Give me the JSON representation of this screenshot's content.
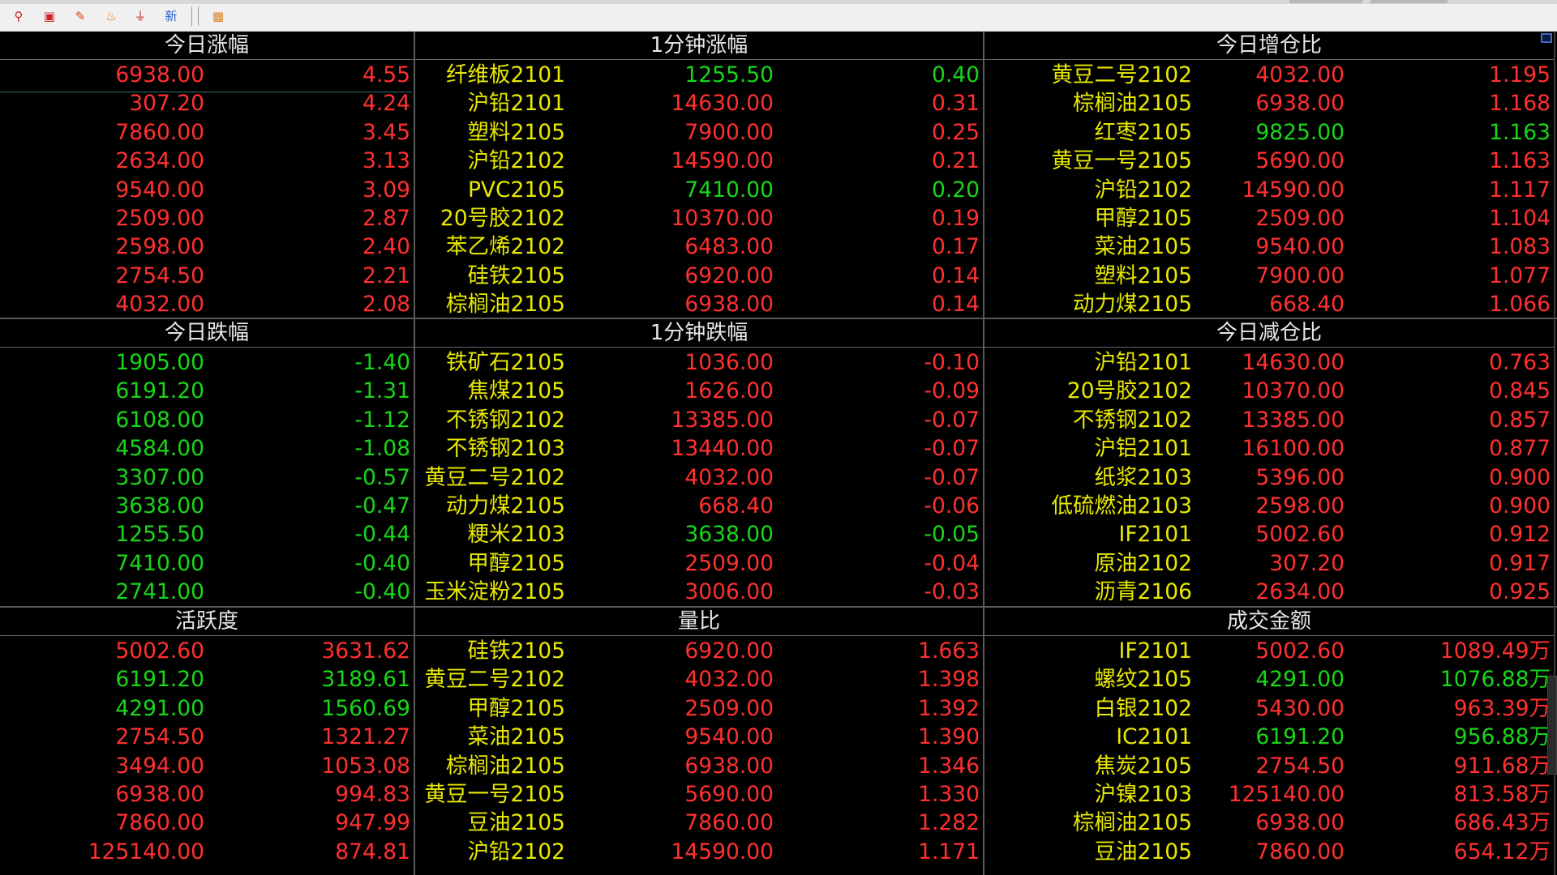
{
  "toolbar": {
    "icons": [
      {
        "name": "search-icon",
        "glyph": "⚲",
        "color": "#d02020"
      },
      {
        "name": "windows-icon",
        "glyph": "▣",
        "color": "#d02020"
      },
      {
        "name": "pencil-icon",
        "glyph": "✎",
        "color": "#e04010"
      },
      {
        "name": "flame-icon",
        "glyph": "♨",
        "color": "#e07010"
      },
      {
        "name": "funnel-icon",
        "glyph": "⏚",
        "color": "#c02020"
      },
      {
        "name": "new-icon",
        "glyph": "新",
        "color": "#2060d0"
      },
      {
        "name": "calendar-icon",
        "glyph": "▦",
        "color": "#e08020"
      }
    ]
  },
  "colors": {
    "up": "#ff3030",
    "down": "#19d619",
    "name": "#e8e800",
    "title": "#e6e6e6"
  },
  "panels": {
    "today_rise": {
      "title": "今日涨幅",
      "rows": [
        {
          "price": "6938.00",
          "change": "4.55",
          "c": "red"
        },
        {
          "price": "307.20",
          "change": "4.24",
          "c": "red"
        },
        {
          "price": "7860.00",
          "change": "3.45",
          "c": "red"
        },
        {
          "price": "2634.00",
          "change": "3.13",
          "c": "red"
        },
        {
          "price": "9540.00",
          "change": "3.09",
          "c": "red"
        },
        {
          "price": "2509.00",
          "change": "2.87",
          "c": "red"
        },
        {
          "price": "2598.00",
          "change": "2.40",
          "c": "red"
        },
        {
          "price": "2754.50",
          "change": "2.21",
          "c": "red"
        },
        {
          "price": "4032.00",
          "change": "2.08",
          "c": "red"
        }
      ]
    },
    "minute_rise": {
      "title": "1分钟涨幅",
      "rows": [
        {
          "name": "纤维板2101",
          "price": "1255.50",
          "value": "0.40",
          "pc": "green",
          "vc": "green"
        },
        {
          "name": "沪铅2101",
          "price": "14630.00",
          "value": "0.31",
          "pc": "red",
          "vc": "red"
        },
        {
          "name": "塑料2105",
          "price": "7900.00",
          "value": "0.25",
          "pc": "red",
          "vc": "red"
        },
        {
          "name": "沪铅2102",
          "price": "14590.00",
          "value": "0.21",
          "pc": "red",
          "vc": "red"
        },
        {
          "name": "PVC2105",
          "price": "7410.00",
          "value": "0.20",
          "pc": "green",
          "vc": "green"
        },
        {
          "name": "20号胶2102",
          "price": "10370.00",
          "value": "0.19",
          "pc": "red",
          "vc": "red"
        },
        {
          "name": "苯乙烯2102",
          "price": "6483.00",
          "value": "0.17",
          "pc": "red",
          "vc": "red"
        },
        {
          "name": "硅铁2105",
          "price": "6920.00",
          "value": "0.14",
          "pc": "red",
          "vc": "red"
        },
        {
          "name": "棕榈油2105",
          "price": "6938.00",
          "value": "0.14",
          "pc": "red",
          "vc": "red"
        }
      ]
    },
    "oi_increase": {
      "title": "今日增仓比",
      "rows": [
        {
          "name": "黄豆二号2102",
          "price": "4032.00",
          "value": "1.195",
          "pc": "red",
          "vc": "red"
        },
        {
          "name": "棕榈油2105",
          "price": "6938.00",
          "value": "1.168",
          "pc": "red",
          "vc": "red"
        },
        {
          "name": "红枣2105",
          "price": "9825.00",
          "value": "1.163",
          "pc": "green",
          "vc": "green"
        },
        {
          "name": "黄豆一号2105",
          "price": "5690.00",
          "value": "1.163",
          "pc": "red",
          "vc": "red"
        },
        {
          "name": "沪铅2102",
          "price": "14590.00",
          "value": "1.117",
          "pc": "red",
          "vc": "red"
        },
        {
          "name": "甲醇2105",
          "price": "2509.00",
          "value": "1.104",
          "pc": "red",
          "vc": "red"
        },
        {
          "name": "菜油2105",
          "price": "9540.00",
          "value": "1.083",
          "pc": "red",
          "vc": "red"
        },
        {
          "name": "塑料2105",
          "price": "7900.00",
          "value": "1.077",
          "pc": "red",
          "vc": "red"
        },
        {
          "name": "动力煤2105",
          "price": "668.40",
          "value": "1.066",
          "pc": "red",
          "vc": "red"
        }
      ]
    },
    "today_fall": {
      "title": "今日跌幅",
      "rows": [
        {
          "price": "1905.00",
          "change": "-1.40",
          "c": "green"
        },
        {
          "price": "6191.20",
          "change": "-1.31",
          "c": "green"
        },
        {
          "price": "6108.00",
          "change": "-1.12",
          "c": "green"
        },
        {
          "price": "4584.00",
          "change": "-1.08",
          "c": "green"
        },
        {
          "price": "3307.00",
          "change": "-0.57",
          "c": "green"
        },
        {
          "price": "3638.00",
          "change": "-0.47",
          "c": "green"
        },
        {
          "price": "1255.50",
          "change": "-0.44",
          "c": "green"
        },
        {
          "price": "7410.00",
          "change": "-0.40",
          "c": "green"
        },
        {
          "price": "2741.00",
          "change": "-0.40",
          "c": "green"
        }
      ]
    },
    "minute_fall": {
      "title": "1分钟跌幅",
      "rows": [
        {
          "name": "铁矿石2105",
          "price": "1036.00",
          "value": "-0.10",
          "pc": "red",
          "vc": "red"
        },
        {
          "name": "焦煤2105",
          "price": "1626.00",
          "value": "-0.09",
          "pc": "red",
          "vc": "red"
        },
        {
          "name": "不锈钢2102",
          "price": "13385.00",
          "value": "-0.07",
          "pc": "red",
          "vc": "red"
        },
        {
          "name": "不锈钢2103",
          "price": "13440.00",
          "value": "-0.07",
          "pc": "red",
          "vc": "red"
        },
        {
          "name": "黄豆二号2102",
          "price": "4032.00",
          "value": "-0.07",
          "pc": "red",
          "vc": "red"
        },
        {
          "name": "动力煤2105",
          "price": "668.40",
          "value": "-0.06",
          "pc": "red",
          "vc": "red"
        },
        {
          "name": "粳米2103",
          "price": "3638.00",
          "value": "-0.05",
          "pc": "green",
          "vc": "green"
        },
        {
          "name": "甲醇2105",
          "price": "2509.00",
          "value": "-0.04",
          "pc": "red",
          "vc": "red"
        },
        {
          "name": "玉米淀粉2105",
          "price": "3006.00",
          "value": "-0.03",
          "pc": "red",
          "vc": "red"
        }
      ]
    },
    "oi_decrease": {
      "title": "今日减仓比",
      "rows": [
        {
          "name": "沪铅2101",
          "price": "14630.00",
          "value": "0.763",
          "pc": "red",
          "vc": "red"
        },
        {
          "name": "20号胶2102",
          "price": "10370.00",
          "value": "0.845",
          "pc": "red",
          "vc": "red"
        },
        {
          "name": "不锈钢2102",
          "price": "13385.00",
          "value": "0.857",
          "pc": "red",
          "vc": "red"
        },
        {
          "name": "沪铝2101",
          "price": "16100.00",
          "value": "0.877",
          "pc": "red",
          "vc": "red"
        },
        {
          "name": "纸浆2103",
          "price": "5396.00",
          "value": "0.900",
          "pc": "red",
          "vc": "red"
        },
        {
          "name": "低硫燃油2103",
          "price": "2598.00",
          "value": "0.900",
          "pc": "red",
          "vc": "red"
        },
        {
          "name": "IF2101",
          "price": "5002.60",
          "value": "0.912",
          "pc": "red",
          "vc": "red"
        },
        {
          "name": "原油2102",
          "price": "307.20",
          "value": "0.917",
          "pc": "red",
          "vc": "red"
        },
        {
          "name": "沥青2106",
          "price": "2634.00",
          "value": "0.925",
          "pc": "red",
          "vc": "red"
        }
      ]
    },
    "activity": {
      "title": "活跃度",
      "rows": [
        {
          "price": "5002.60",
          "change": "3631.62",
          "pc": "red",
          "cc": "red"
        },
        {
          "price": "6191.20",
          "change": "3189.61",
          "pc": "green",
          "cc": "green"
        },
        {
          "price": "4291.00",
          "change": "1560.69",
          "pc": "green",
          "cc": "green"
        },
        {
          "price": "2754.50",
          "change": "1321.27",
          "pc": "red",
          "cc": "red"
        },
        {
          "price": "3494.00",
          "change": "1053.08",
          "pc": "red",
          "cc": "red"
        },
        {
          "price": "6938.00",
          "change": "994.83",
          "pc": "red",
          "cc": "red"
        },
        {
          "price": "7860.00",
          "change": "947.99",
          "pc": "red",
          "cc": "red"
        },
        {
          "price": "125140.00",
          "change": "874.81",
          "pc": "red",
          "cc": "red"
        }
      ]
    },
    "volume_ratio": {
      "title": "量比",
      "rows": [
        {
          "name": "硅铁2105",
          "price": "6920.00",
          "value": "1.663",
          "pc": "red",
          "vc": "red"
        },
        {
          "name": "黄豆二号2102",
          "price": "4032.00",
          "value": "1.398",
          "pc": "red",
          "vc": "red"
        },
        {
          "name": "甲醇2105",
          "price": "2509.00",
          "value": "1.392",
          "pc": "red",
          "vc": "red"
        },
        {
          "name": "菜油2105",
          "price": "9540.00",
          "value": "1.390",
          "pc": "red",
          "vc": "red"
        },
        {
          "name": "棕榈油2105",
          "price": "6938.00",
          "value": "1.346",
          "pc": "red",
          "vc": "red"
        },
        {
          "name": "黄豆一号2105",
          "price": "5690.00",
          "value": "1.330",
          "pc": "red",
          "vc": "red"
        },
        {
          "name": "豆油2105",
          "price": "7860.00",
          "value": "1.282",
          "pc": "red",
          "vc": "red"
        },
        {
          "name": "沪铅2102",
          "price": "14590.00",
          "value": "1.171",
          "pc": "red",
          "vc": "red"
        }
      ]
    },
    "turnover": {
      "title": "成交金额",
      "rows": [
        {
          "name": "IF2101",
          "price": "5002.60",
          "value": "1089.49万",
          "pc": "red",
          "vc": "red"
        },
        {
          "name": "螺纹2105",
          "price": "4291.00",
          "value": "1076.88万",
          "pc": "green",
          "vc": "green"
        },
        {
          "name": "白银2102",
          "price": "5430.00",
          "value": "963.39万",
          "pc": "red",
          "vc": "red"
        },
        {
          "name": "IC2101",
          "price": "6191.20",
          "value": "956.88万",
          "pc": "green",
          "vc": "green"
        },
        {
          "name": "焦炭2105",
          "price": "2754.50",
          "value": "911.68万",
          "pc": "red",
          "vc": "red"
        },
        {
          "name": "沪镍2103",
          "price": "125140.00",
          "value": "813.58万",
          "pc": "red",
          "vc": "red"
        },
        {
          "name": "棕榈油2105",
          "price": "6938.00",
          "value": "686.43万",
          "pc": "red",
          "vc": "red"
        },
        {
          "name": "豆油2105",
          "price": "7860.00",
          "value": "654.12万",
          "pc": "red",
          "vc": "red"
        }
      ]
    }
  }
}
